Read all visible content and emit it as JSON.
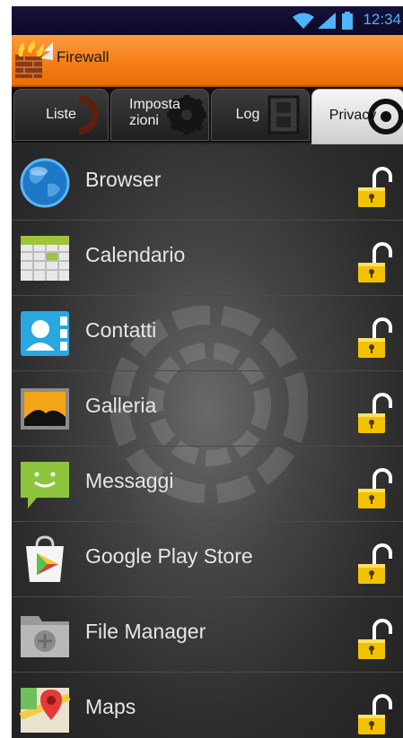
{
  "status_bar": {
    "time": "12:34",
    "icons": [
      "wifi-icon",
      "signal-icon",
      "battery-icon"
    ]
  },
  "header": {
    "title": "Firewall",
    "logo_icon": "firewall-brick-icon"
  },
  "tabs": [
    {
      "label": "Liste",
      "active": false
    },
    {
      "label": "Imposta zioni",
      "active": false
    },
    {
      "label": "Log",
      "active": false
    },
    {
      "label": "Privacy",
      "active": true
    }
  ],
  "apps": [
    {
      "name": "Browser",
      "icon": "globe-icon",
      "locked": false
    },
    {
      "name": "Calendario",
      "icon": "calendar-icon",
      "locked": false
    },
    {
      "name": "Contatti",
      "icon": "contacts-icon",
      "locked": false
    },
    {
      "name": "Galleria",
      "icon": "gallery-icon",
      "locked": false
    },
    {
      "name": "Messaggi",
      "icon": "message-icon",
      "locked": false
    },
    {
      "name": "Google Play Store",
      "icon": "play-store-icon",
      "locked": false
    },
    {
      "name": "File Manager",
      "icon": "folder-icon",
      "locked": false
    },
    {
      "name": "Maps",
      "icon": "maps-icon",
      "locked": false
    }
  ],
  "colors": {
    "accent": "#f57f16",
    "lock": "#f2c200",
    "status_text": "#4fb3ff"
  }
}
